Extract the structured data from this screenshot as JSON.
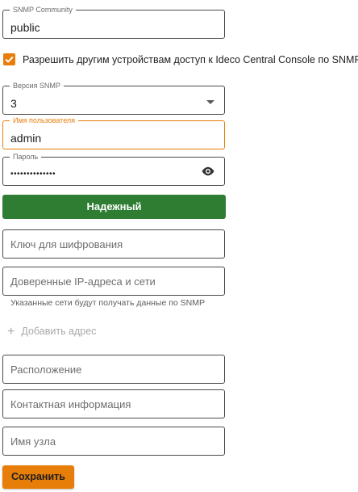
{
  "community": {
    "label": "SNMP Community",
    "value": "public"
  },
  "allow_access": {
    "label": "Разрешить другим устройствам доступ к Ideco Central Console по SNMP",
    "checked": true
  },
  "version": {
    "label": "Версия SNMP",
    "value": "3"
  },
  "username": {
    "label": "Имя пользователя",
    "value": "admin"
  },
  "password": {
    "label": "Пароль",
    "value": "••••••••••••••"
  },
  "strength": {
    "label": "Надежный",
    "color": "#2e7d32"
  },
  "encryption_key": {
    "placeholder": "Ключ для шифрования"
  },
  "trusted": {
    "placeholder": "Доверенные IP-адреса и сети",
    "helper": "Указанные сети будут получать данные по SNMP"
  },
  "add_address": {
    "plus": "+",
    "label": "Добавить адрес"
  },
  "location": {
    "placeholder": "Расположение"
  },
  "contact": {
    "placeholder": "Контактная информация"
  },
  "hostname": {
    "placeholder": "Имя узла"
  },
  "save": {
    "label": "Сохранить"
  },
  "colors": {
    "accent": "#e87e0a",
    "success": "#2e7d32"
  }
}
